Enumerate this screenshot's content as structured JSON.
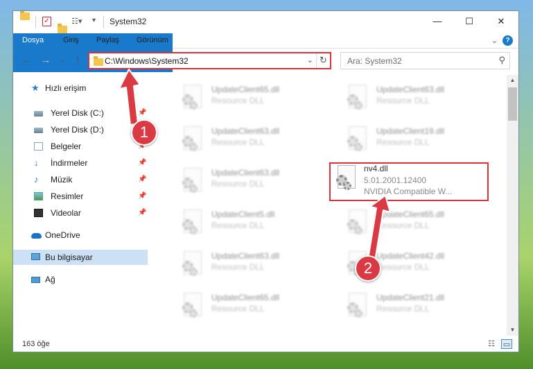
{
  "window": {
    "title": "System32",
    "controls": {
      "minimize": "—",
      "maximize": "☐",
      "close": "✕"
    }
  },
  "ribbon": {
    "tabs": [
      "Dosya",
      "Giriş",
      "Paylaş",
      "Görünüm"
    ],
    "collapse": "⌄",
    "help": "?"
  },
  "nav": {
    "back": "←",
    "forward": "→",
    "recent": "⌄",
    "up": "↑",
    "address": "C:\\Windows\\System32",
    "address_dropdown": "⌄",
    "refresh": "↻",
    "search_placeholder": "Ara: System32",
    "search_icon": "⚲"
  },
  "sidebar": {
    "items": [
      {
        "label": "Hızlı erişim",
        "icon": "star-icon",
        "pinned": false
      },
      {
        "label": "Yerel Disk (C:)",
        "icon": "drive-icon",
        "pinned": true
      },
      {
        "label": "Yerel Disk (D:)",
        "icon": "drive-icon",
        "pinned": true
      },
      {
        "label": "Belgeler",
        "icon": "document-folder-icon",
        "pinned": true
      },
      {
        "label": "İndirmeler",
        "icon": "download-icon",
        "pinned": true
      },
      {
        "label": "Müzik",
        "icon": "music-icon",
        "pinned": true
      },
      {
        "label": "Resimler",
        "icon": "pictures-icon",
        "pinned": true
      },
      {
        "label": "Videolar",
        "icon": "video-icon",
        "pinned": true
      },
      {
        "label": "OneDrive",
        "icon": "cloud-icon",
        "pinned": false
      },
      {
        "label": "Bu bilgisayar",
        "icon": "computer-icon",
        "pinned": false,
        "selected": true
      },
      {
        "label": "Ağ",
        "icon": "network-icon",
        "pinned": false
      }
    ],
    "pin_glyph": "📌"
  },
  "files": [
    {
      "name": "UpdateClient65.dll",
      "desc": "Resource DLL"
    },
    {
      "name": "UpdateClient63.dll",
      "desc": "Resource DLL"
    },
    {
      "name": "UpdateClient63.dll",
      "desc": "Resource DLL"
    },
    {
      "name": "UpdateClient19.dll",
      "desc": "Resource DLL"
    },
    {
      "name": "UpdateClient63.dll",
      "desc": "Resource DLL"
    },
    {
      "name": "nv4.dll",
      "desc": "5.01.2001.12400",
      "desc2": "NVIDIA Compatible W...",
      "highlighted": true
    },
    {
      "name": "UpdateClient5.dll",
      "desc": "Resource DLL"
    },
    {
      "name": "UpdateClient65.dll",
      "desc": "Resource DLL"
    },
    {
      "name": "UpdateClient63.dll",
      "desc": "Resource DLL"
    },
    {
      "name": "UpdateClient42.dll",
      "desc": "Resource DLL"
    },
    {
      "name": "UpdateClient65.dll",
      "desc": "Resource DLL"
    },
    {
      "name": "UpdateClient21.dll",
      "desc": "Resource DLL"
    }
  ],
  "status": {
    "count": "163 öğe",
    "view_details": "☷",
    "view_tiles": "▭"
  },
  "annotations": {
    "badge1": "1",
    "badge2": "2",
    "color": "#d93a43"
  }
}
